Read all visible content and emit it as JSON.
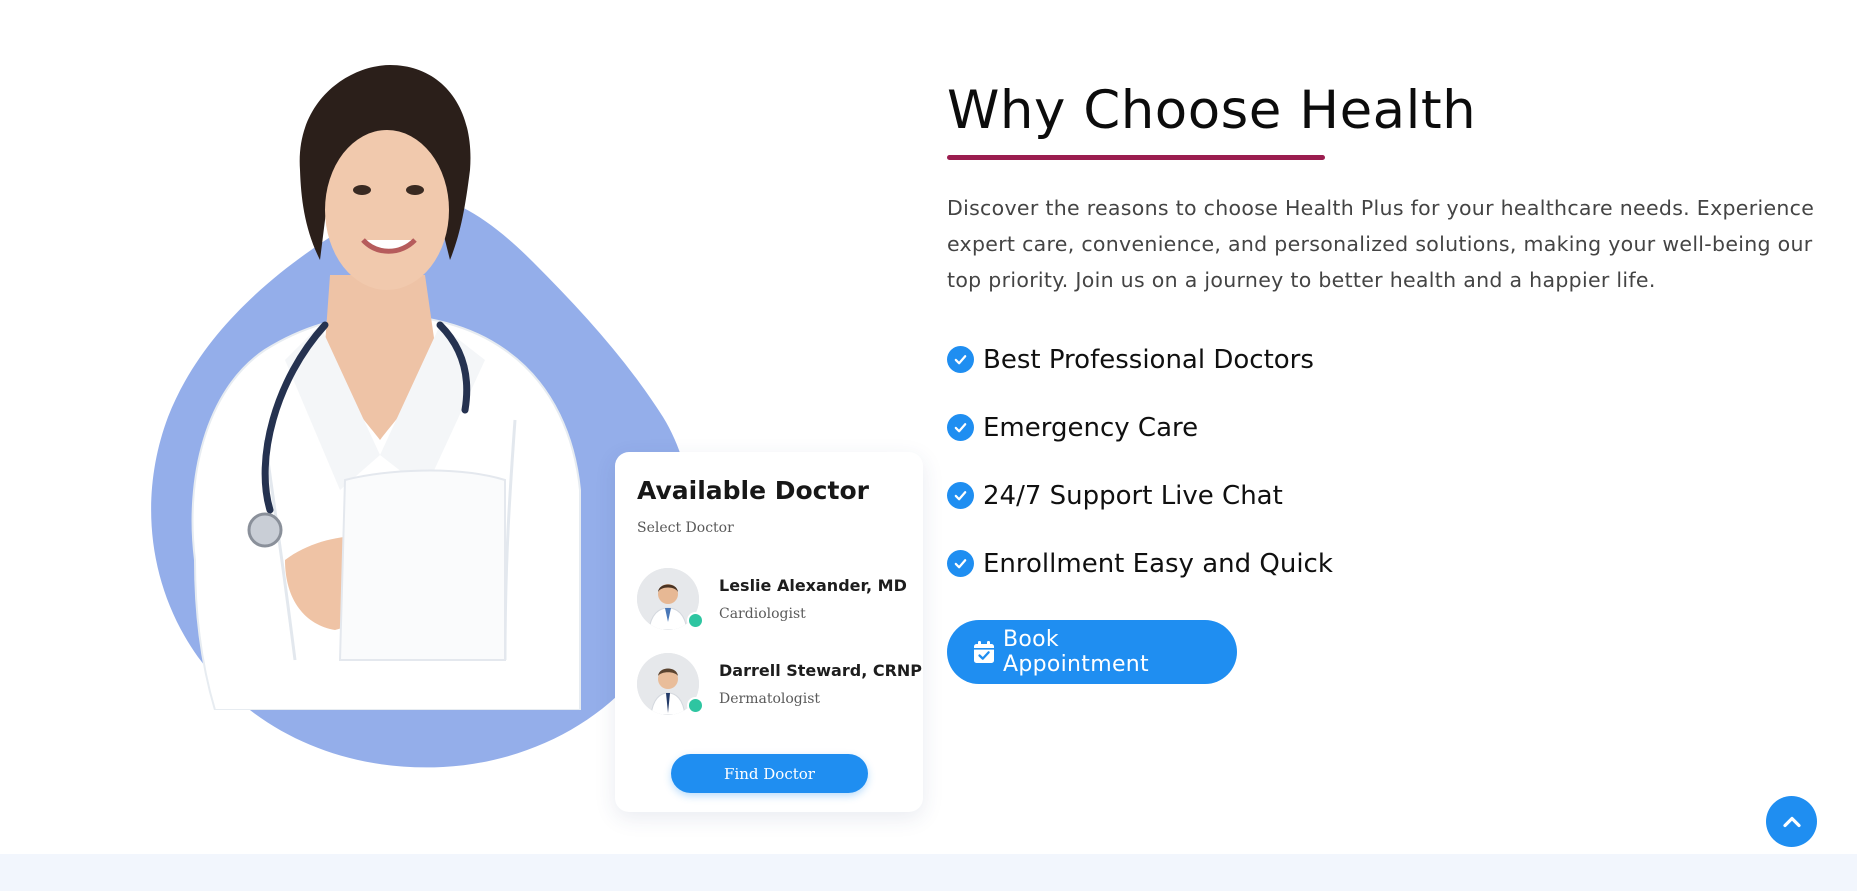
{
  "why_section": {
    "title": "Why Choose Health",
    "intro": "Discover the reasons to choose Health Plus for your healthcare needs. Experience expert care, convenience, and personalized solutions, making your well-being our top priority. Join us on a journey to better health and a happier life.",
    "features": [
      {
        "label": "Best Professional Doctors",
        "icon": "check-circle-icon"
      },
      {
        "label": "Emergency Care",
        "icon": "check-circle-icon"
      },
      {
        "label": "24/7 Support Live Chat",
        "icon": "check-circle-icon"
      },
      {
        "label": "Enrollment Easy and Quick",
        "icon": "check-circle-icon"
      }
    ],
    "cta": {
      "label": "Book Appointment",
      "icon": "calendar-check-icon"
    }
  },
  "available_card": {
    "title": "Available Doctor",
    "subtitle": "Select Doctor",
    "doctors": [
      {
        "name": "Leslie Alexander, MD",
        "specialty": "Cardiologist",
        "status": "online"
      },
      {
        "name": "Darrell Steward, CRNP",
        "specialty": "Dermatologist",
        "status": "online"
      }
    ],
    "button_label": "Find Doctor"
  },
  "scroll_top": {
    "icon": "chevron-up-icon"
  },
  "colors": {
    "accent": "#1f8ef1",
    "underline": "#9b1d4f",
    "blob": "#94aeea",
    "online": "#2ec5a1",
    "band": "#f2f6fd"
  }
}
